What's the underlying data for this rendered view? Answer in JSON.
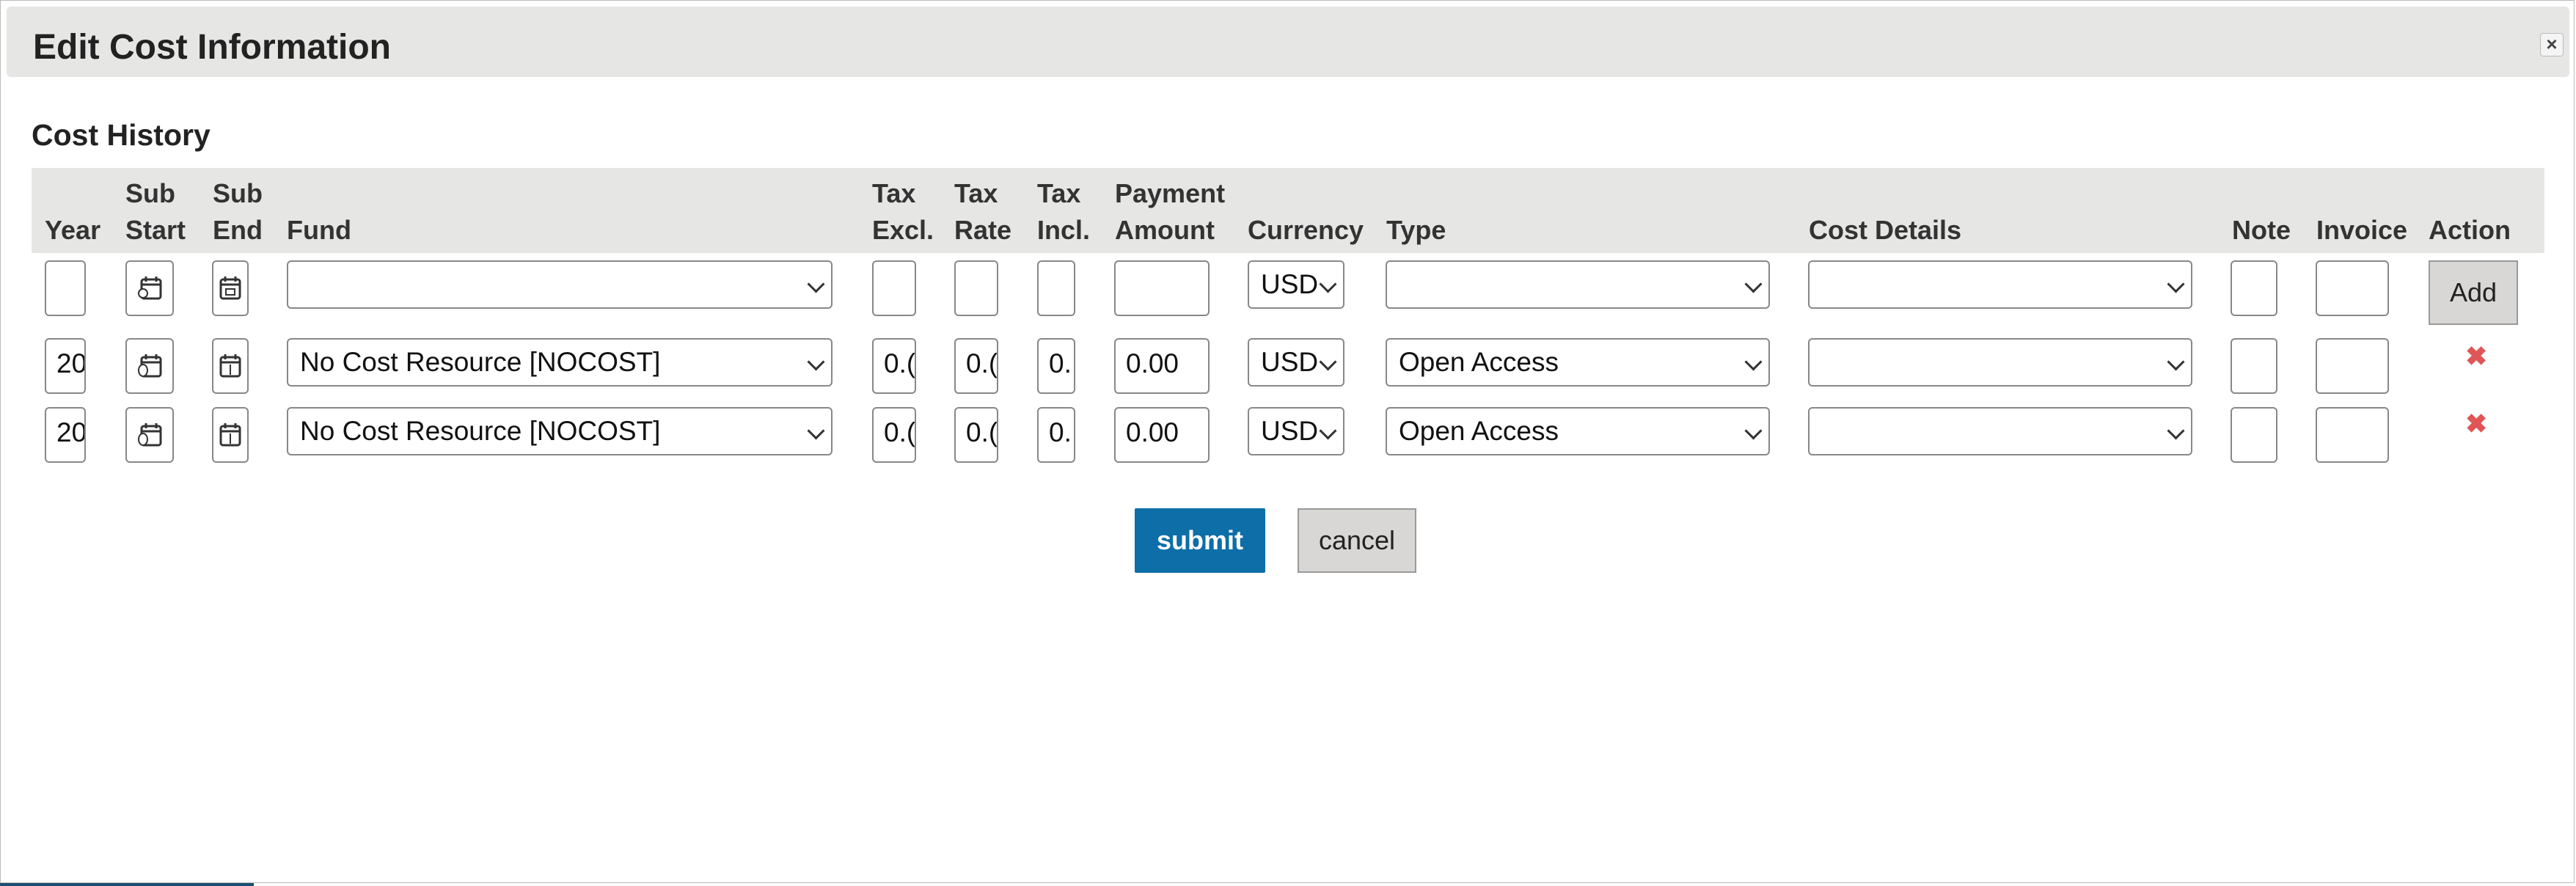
{
  "dialog": {
    "title": "Edit Cost Information",
    "close_label": "×",
    "section_title": "Cost History"
  },
  "columns": {
    "year": [
      "Year"
    ],
    "sub_start": [
      "Sub",
      "Start"
    ],
    "sub_end": [
      "Sub",
      "End"
    ],
    "fund": [
      "Fund"
    ],
    "tax_excl": [
      "Tax",
      "Excl."
    ],
    "tax_rate": [
      "Tax",
      "Rate"
    ],
    "tax_incl": [
      "Tax",
      "Incl."
    ],
    "payment_amount": [
      "Payment",
      "Amount"
    ],
    "currency": [
      "Currency"
    ],
    "type": [
      "Type"
    ],
    "cost_details": [
      "Cost Details"
    ],
    "note": [
      "Note"
    ],
    "invoice": [
      "Invoice"
    ],
    "action": [
      "Action"
    ]
  },
  "new_row": {
    "year": "",
    "fund": "",
    "tax_excl": "",
    "tax_rate": "",
    "tax_incl": "",
    "payment_amount": "",
    "currency": "USD",
    "type": "",
    "cost_details": "",
    "note": "",
    "invoice": "",
    "add_label": "Add"
  },
  "rows": [
    {
      "year": "20",
      "fund": "No Cost Resource [NOCOST]",
      "tax_excl": "0.(",
      "tax_rate": "0.(",
      "tax_incl": "0.",
      "payment_amount": "0.00",
      "currency": "USD",
      "type": "Open Access",
      "cost_details": "",
      "note": "",
      "invoice": "",
      "delete_label": "✖"
    },
    {
      "year": "20",
      "fund": "No Cost Resource [NOCOST]",
      "tax_excl": "0.(",
      "tax_rate": "0.(",
      "tax_incl": "0.",
      "payment_amount": "0.00",
      "currency": "USD",
      "type": "Open Access",
      "cost_details": "",
      "note": "",
      "invoice": "",
      "delete_label": "✖"
    }
  ],
  "buttons": {
    "submit": "submit",
    "cancel": "cancel"
  },
  "icons": {
    "calendar": "calendar-icon",
    "chevron": "chevron-down-icon",
    "delete": "delete-icon"
  },
  "colors": {
    "header_bg": "#e6e6e5",
    "submit_bg": "#0d6ea8",
    "delete": "#e05555",
    "button_gray": "#d9d7d5"
  }
}
